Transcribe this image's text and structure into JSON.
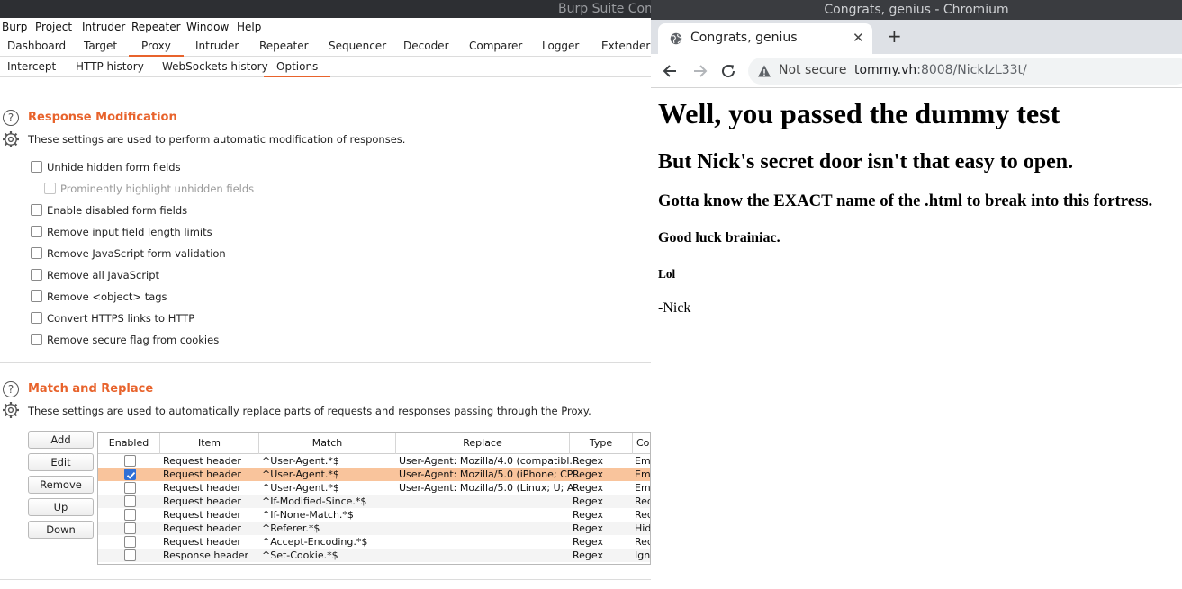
{
  "burp": {
    "title": "Burp Suite Com",
    "menu": [
      "Burp",
      "Project",
      "Intruder",
      "Repeater",
      "Window",
      "Help"
    ],
    "main_tabs": [
      "Dashboard",
      "Target",
      "Proxy",
      "Intruder",
      "Repeater",
      "Sequencer",
      "Decoder",
      "Comparer",
      "Logger",
      "Extender"
    ],
    "active_main_tab": "Proxy",
    "sub_tabs": [
      "Intercept",
      "HTTP history",
      "WebSockets history",
      "Options"
    ],
    "active_sub_tab": "Options",
    "accent_color": "#e8632c",
    "response_modification": {
      "title": "Response Modification",
      "description": "These settings are used to perform automatic modification of responses.",
      "options": [
        {
          "label": "Unhide hidden form fields",
          "checked": false,
          "enabled": true
        },
        {
          "label": "Prominently highlight unhidden fields",
          "checked": false,
          "enabled": false
        },
        {
          "label": "Enable disabled form fields",
          "checked": false,
          "enabled": true
        },
        {
          "label": "Remove input field length limits",
          "checked": false,
          "enabled": true
        },
        {
          "label": "Remove JavaScript form validation",
          "checked": false,
          "enabled": true
        },
        {
          "label": "Remove all JavaScript",
          "checked": false,
          "enabled": true
        },
        {
          "label": "Remove <object> tags",
          "checked": false,
          "enabled": true
        },
        {
          "label": "Convert HTTPS links to HTTP",
          "checked": false,
          "enabled": true
        },
        {
          "label": "Remove secure flag from cookies",
          "checked": false,
          "enabled": true
        }
      ]
    },
    "match_replace": {
      "title": "Match and Replace",
      "description": "These settings are used to automatically replace parts of requests and responses passing through the Proxy.",
      "buttons": [
        "Add",
        "Edit",
        "Remove",
        "Up",
        "Down"
      ],
      "columns": [
        "Enabled",
        "Item",
        "Match",
        "Replace",
        "Type",
        "Comment"
      ],
      "rows": [
        {
          "enabled": false,
          "item": "Request header",
          "match": "^User-Agent.*$",
          "replace": "User-Agent: Mozilla/4.0 (compatibl...",
          "type": "Regex",
          "comment": "Emulate IE",
          "selected": false
        },
        {
          "enabled": true,
          "item": "Request header",
          "match": "^User-Agent.*$",
          "replace": "User-Agent: Mozilla/5.0 (iPhone; CP...",
          "type": "Regex",
          "comment": "Emulate iOS",
          "selected": true
        },
        {
          "enabled": false,
          "item": "Request header",
          "match": "^User-Agent.*$",
          "replace": "User-Agent: Mozilla/5.0 (Linux; U; A...",
          "type": "Regex",
          "comment": "Emulate Android",
          "selected": false
        },
        {
          "enabled": false,
          "item": "Request header",
          "match": "^If-Modified-Since.*$",
          "replace": "",
          "type": "Regex",
          "comment": "Require non-cached response",
          "selected": false
        },
        {
          "enabled": false,
          "item": "Request header",
          "match": "^If-None-Match.*$",
          "replace": "",
          "type": "Regex",
          "comment": "Require non-cached response",
          "selected": false
        },
        {
          "enabled": false,
          "item": "Request header",
          "match": "^Referer.*$",
          "replace": "",
          "type": "Regex",
          "comment": "Hide Referer header",
          "selected": false
        },
        {
          "enabled": false,
          "item": "Request header",
          "match": "^Accept-Encoding.*$",
          "replace": "",
          "type": "Regex",
          "comment": "Require non-compressed responses",
          "selected": false
        },
        {
          "enabled": false,
          "item": "Response header",
          "match": "^Set-Cookie.*$",
          "replace": "",
          "type": "Regex",
          "comment": "Ignore cookies",
          "selected": false
        }
      ]
    }
  },
  "chromium": {
    "window_title": "Congrats, genius - Chromium",
    "tab_title": "Congrats, genius",
    "security_label": "Not secure",
    "url_host": "tommy.vh",
    "url_rest": ":8008/NickIzL33t/",
    "page": {
      "h1": "Well, you passed the dummy test",
      "h2": "But Nick's secret door isn't that easy to open.",
      "h3": "Gotta know the EXACT name of the .html to break into this fortress.",
      "h4": "Good luck brainiac.",
      "h5": "Lol",
      "p": "-Nick"
    }
  }
}
